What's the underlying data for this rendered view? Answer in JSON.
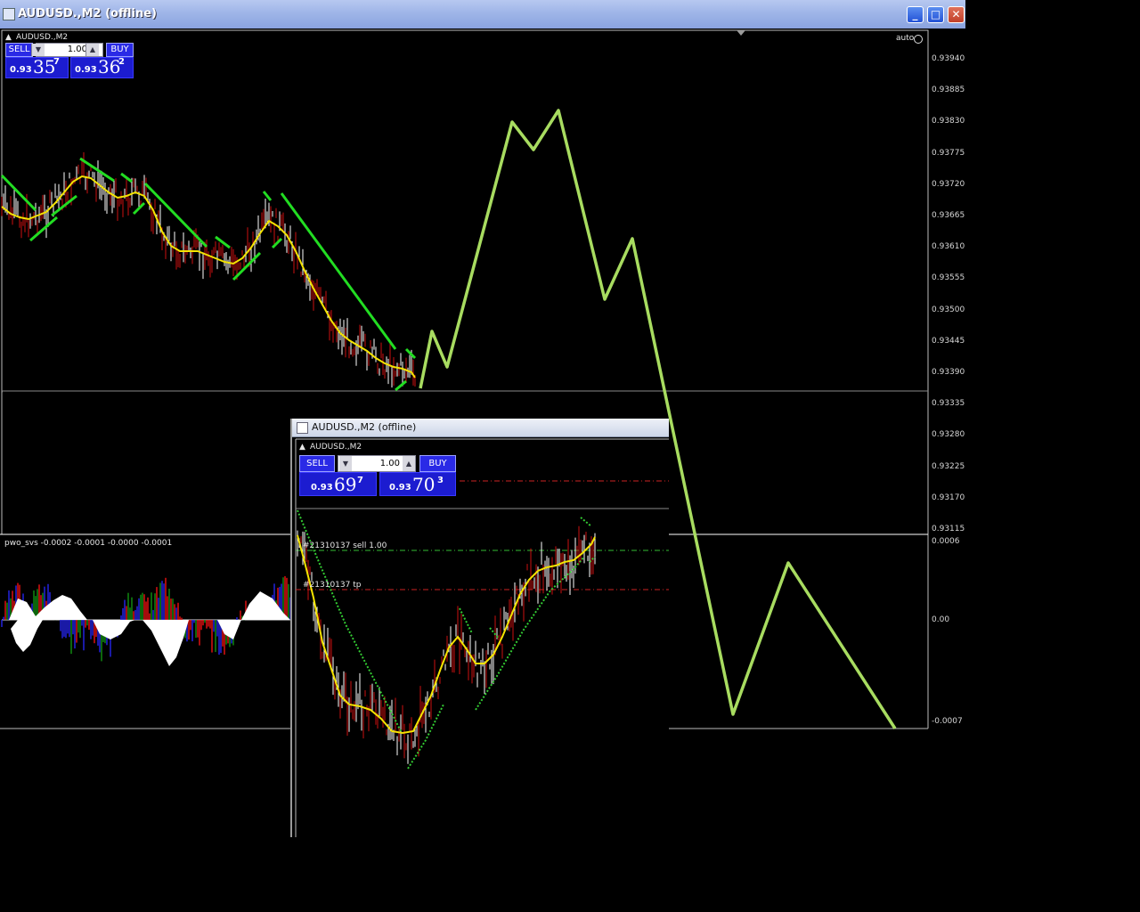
{
  "window": {
    "title": "AUDUSD.,M2 (offline)"
  },
  "controls": {
    "minimize": "_",
    "maximize": "□",
    "close": "✕"
  },
  "main_chart": {
    "symbol_label": "AUDUSD.,M2",
    "auto_label": "auto",
    "price_axis": [
      "0.93940",
      "0.93885",
      "0.93830",
      "0.93775",
      "0.93720",
      "0.93665",
      "0.93610",
      "0.93555",
      "0.93500",
      "0.93445",
      "0.93390",
      "0.93335",
      "0.93280",
      "0.93225",
      "0.93170",
      "0.93115"
    ],
    "trade": {
      "sell_label": "SELL",
      "buy_label": "BUY",
      "lots": "1.00",
      "bid_prefix": "0.93",
      "bid_big": "35",
      "bid_sup": "7",
      "ask_prefix": "0.93",
      "ask_big": "36",
      "ask_sup": "2"
    }
  },
  "indicator": {
    "label": "pwo_svs -0.0002 -0.0001 -0.0000 -0.0001",
    "axis": [
      "0.0006",
      "0.00",
      "-0.0007"
    ]
  },
  "inner_window": {
    "title": "AUDUSD.,M2 (offline)",
    "symbol_label": "AUDUSD.,M2",
    "order_line": "#21310137 sell 1.00",
    "tp_line": "#21310137 tp",
    "trade": {
      "sell_label": "SELL",
      "buy_label": "BUY",
      "lots": "1.00",
      "bid_prefix": "0.93",
      "bid_big": "69",
      "bid_sup": "7",
      "ask_prefix": "0.93",
      "ask_big": "70",
      "ask_sup": "3"
    }
  },
  "colors": {
    "zigzag": "#a8dc60",
    "ma": "#f5e400",
    "trend_green": "#22dd22",
    "candle_up": "#ffffff",
    "candle_down": "#cc0000",
    "titlebar": "#9fb5e8",
    "trade_blue": "#1c1cd0",
    "tp_line": "#cc2222",
    "order_line": "#33bb33"
  }
}
